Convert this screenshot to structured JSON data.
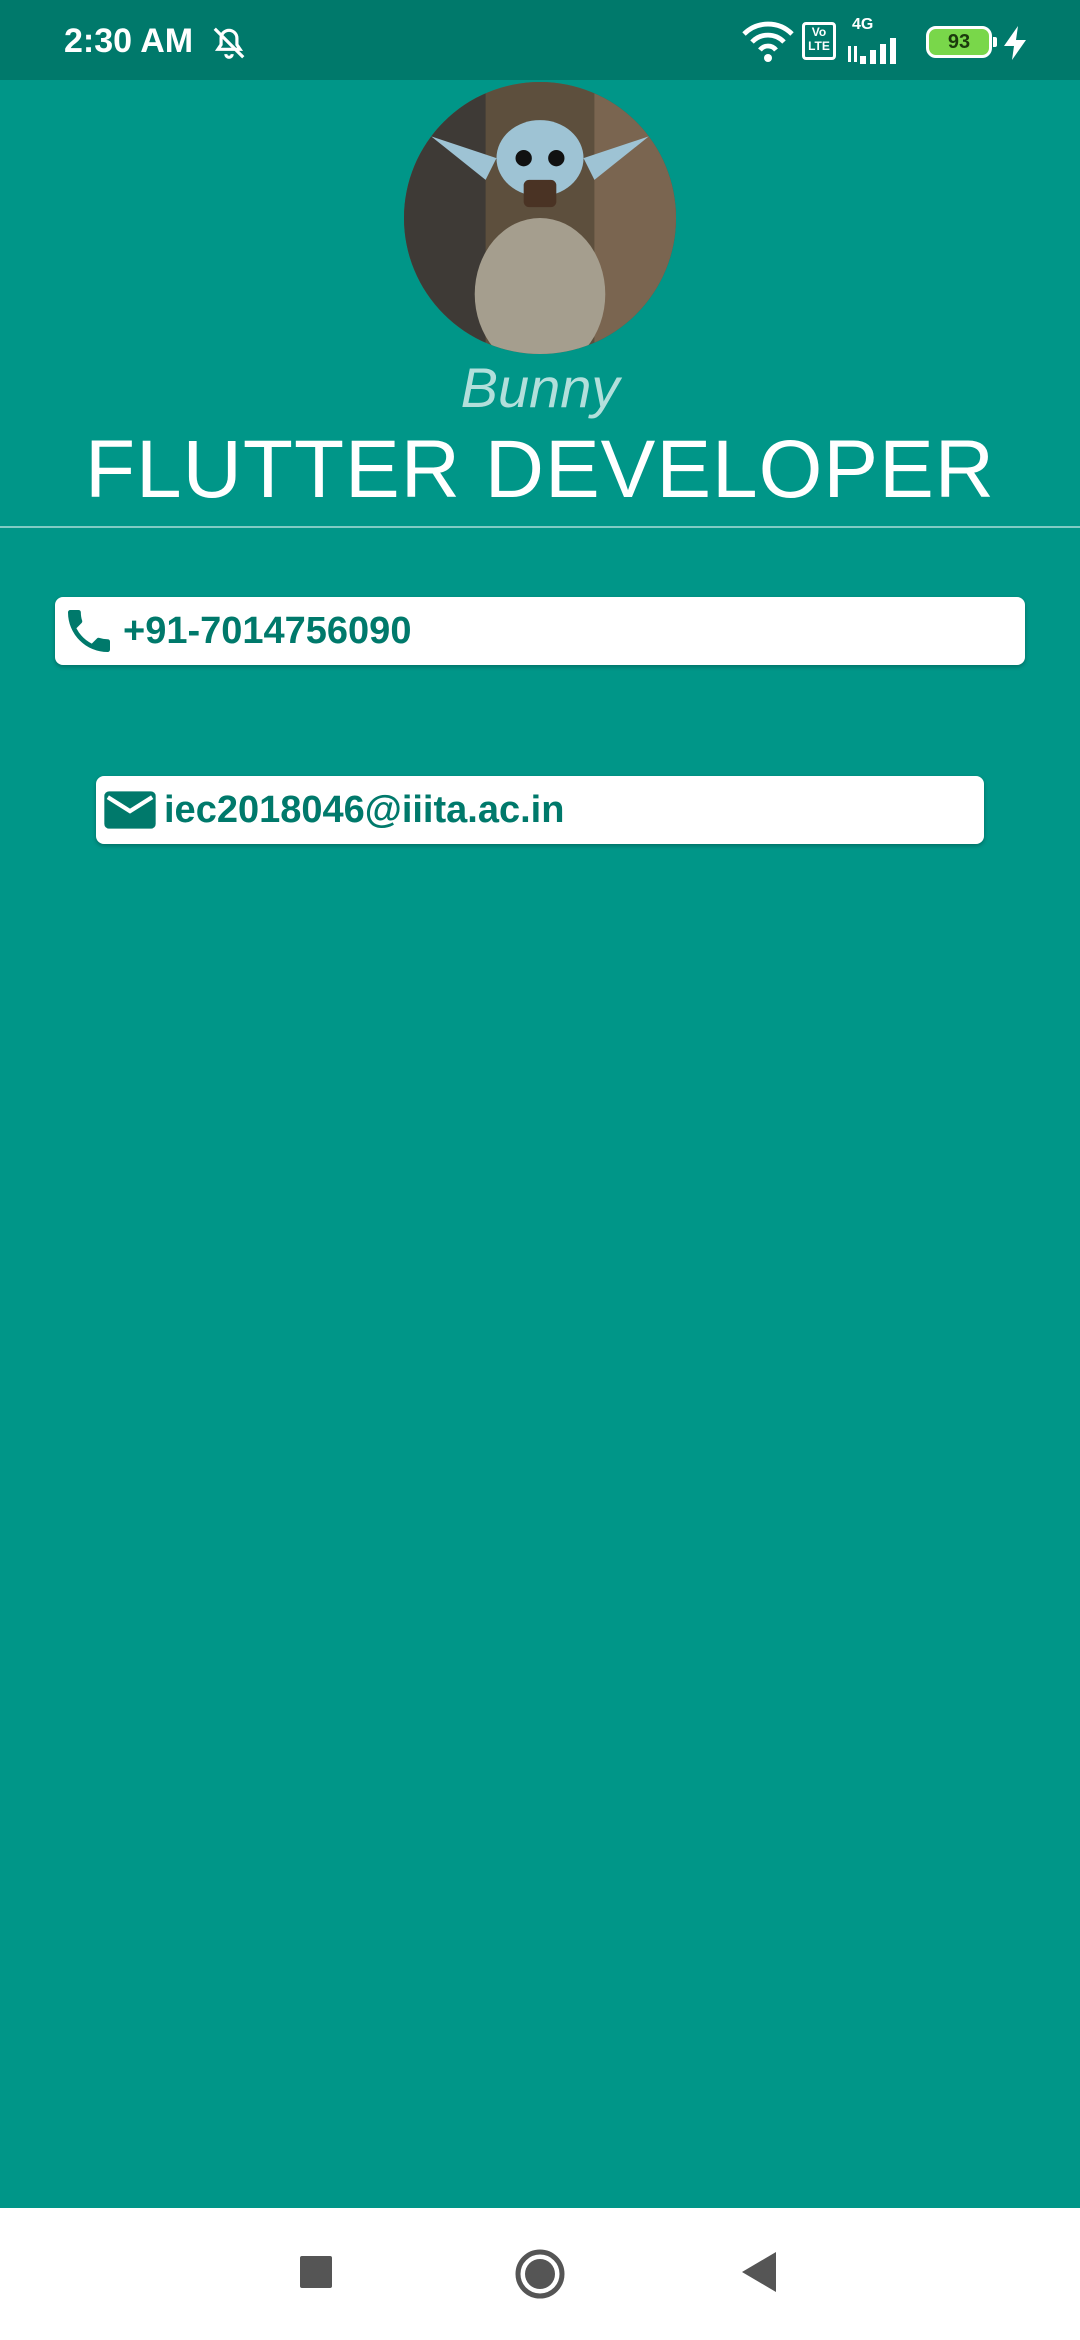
{
  "status_bar": {
    "time": "2:30 AM",
    "left_icon": "alarm-off-icon",
    "network_type": "4G",
    "volte_label": "Vo LTE",
    "battery_level": "93",
    "icons": [
      "wifi-icon",
      "volte-icon",
      "signal-icon",
      "battery-icon",
      "charging-icon"
    ]
  },
  "profile": {
    "avatar_icon": "avatar-image",
    "name": "Bunny",
    "title": "FLUTTER DEVELOPER"
  },
  "contacts": {
    "phone": {
      "icon": "phone-icon",
      "value": "+91-7014756090"
    },
    "email": {
      "icon": "mail-icon",
      "value": "iec2018046@iiita.ac.in"
    }
  },
  "nav_bar": {
    "buttons": [
      "recents-button",
      "home-button",
      "back-button"
    ]
  },
  "colors": {
    "background": "#009688",
    "status_bar": "#00796b",
    "accent_text": "#00796b",
    "card": "#ffffff"
  }
}
